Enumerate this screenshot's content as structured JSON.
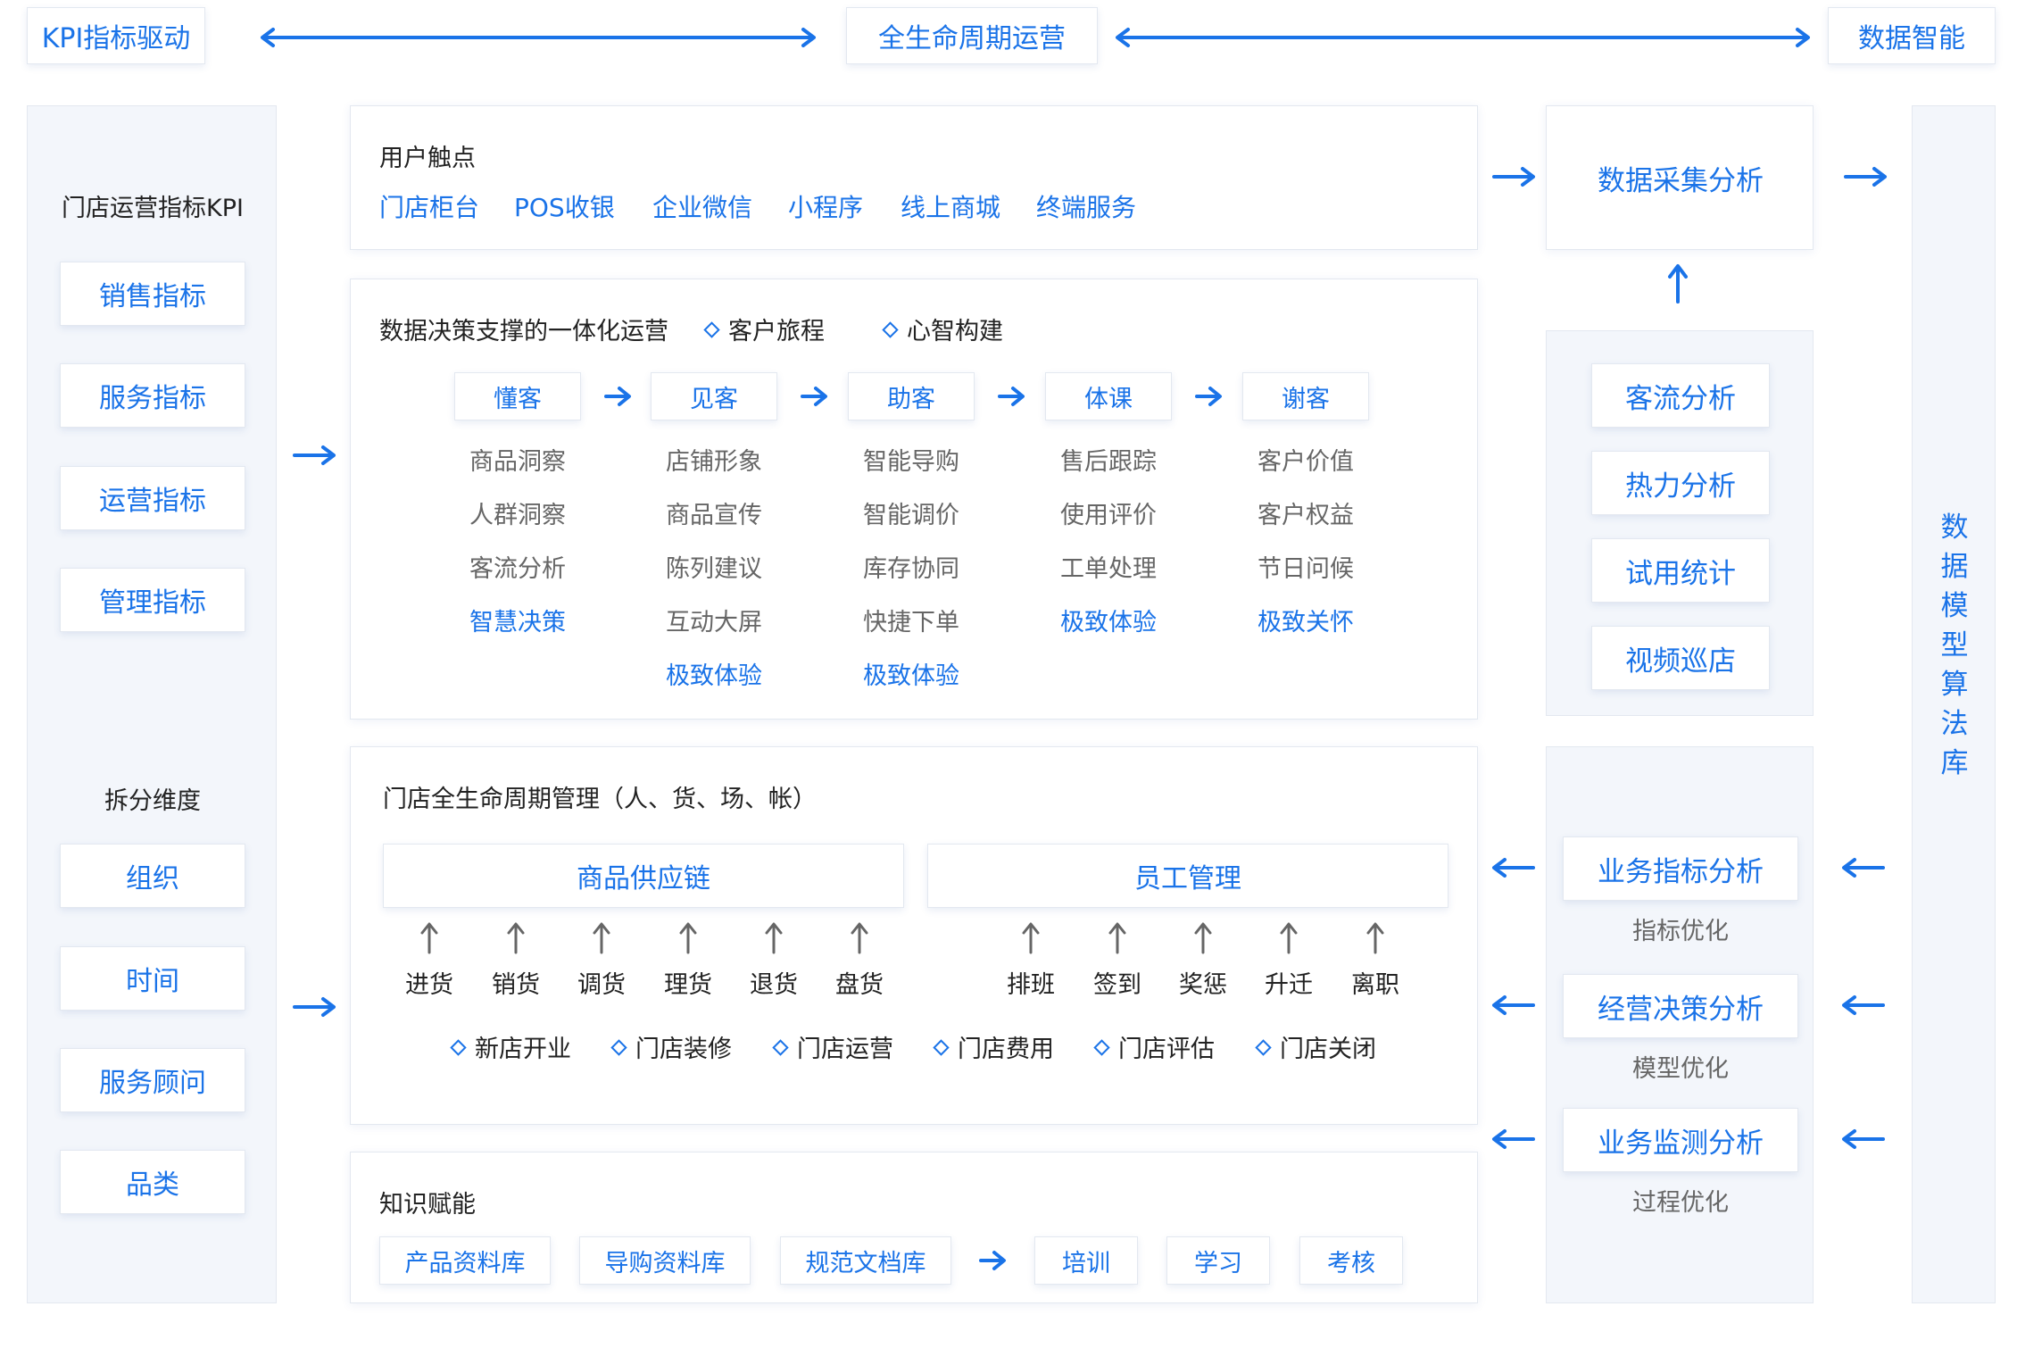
{
  "top": {
    "left": "KPI指标驱动",
    "center": "全生命周期运营",
    "right": "数据智能"
  },
  "left": {
    "kpi_title": "门店运营指标KPI",
    "kpi_items": [
      "销售指标",
      "服务指标",
      "运营指标",
      "管理指标"
    ],
    "dim_title": "拆分维度",
    "dim_items": [
      "组织",
      "时间",
      "服务顾问",
      "品类"
    ]
  },
  "touchpoints": {
    "title": "用户触点",
    "items": [
      "门店柜台",
      "POS收银",
      "企业微信",
      "小程序",
      "线上商城",
      "终端服务"
    ]
  },
  "ops": {
    "title": "数据决策支撑的一体化运营",
    "tags": [
      "客户旅程",
      "心智构建"
    ],
    "columns": [
      {
        "head": "懂客",
        "items": [
          {
            "t": "商品洞察",
            "hl": false
          },
          {
            "t": "人群洞察",
            "hl": false
          },
          {
            "t": "客流分析",
            "hl": false
          },
          {
            "t": "智慧决策",
            "hl": true
          }
        ]
      },
      {
        "head": "见客",
        "items": [
          {
            "t": "店铺形象",
            "hl": false
          },
          {
            "t": "商品宣传",
            "hl": false
          },
          {
            "t": "陈列建议",
            "hl": false
          },
          {
            "t": "互动大屏",
            "hl": false
          },
          {
            "t": "极致体验",
            "hl": true
          }
        ]
      },
      {
        "head": "助客",
        "items": [
          {
            "t": "智能导购",
            "hl": false
          },
          {
            "t": "智能调价",
            "hl": false
          },
          {
            "t": "库存协同",
            "hl": false
          },
          {
            "t": "快捷下单",
            "hl": false
          },
          {
            "t": "极致体验",
            "hl": true
          }
        ]
      },
      {
        "head": "体课",
        "items": [
          {
            "t": "售后跟踪",
            "hl": false
          },
          {
            "t": "使用评价",
            "hl": false
          },
          {
            "t": "工单处理",
            "hl": false
          },
          {
            "t": "极致体验",
            "hl": true
          }
        ]
      },
      {
        "head": "谢客",
        "items": [
          {
            "t": "客户价值",
            "hl": false
          },
          {
            "t": "客户权益",
            "hl": false
          },
          {
            "t": "节日问候",
            "hl": false
          },
          {
            "t": "极致关怀",
            "hl": true
          }
        ]
      }
    ]
  },
  "lifecycle": {
    "title": "门店全生命周期管理（人、货、场、帐）",
    "supply_title": "商品供应链",
    "supply_items": [
      "进货",
      "销货",
      "调货",
      "理货",
      "退货",
      "盘货"
    ],
    "staff_title": "员工管理",
    "staff_items": [
      "排班",
      "签到",
      "奖惩",
      "升迁",
      "离职"
    ],
    "stages": [
      "新店开业",
      "门店装修",
      "门店运营",
      "门店费用",
      "门店评估",
      "门店关闭"
    ]
  },
  "knowledge": {
    "title": "知识赋能",
    "libs": [
      "产品资料库",
      "导购资料库",
      "规范文档库"
    ],
    "steps": [
      "培训",
      "学习",
      "考核"
    ]
  },
  "right": {
    "collect": "数据采集分析",
    "analysis": [
      "客流分析",
      "热力分析",
      "试用统计",
      "视频巡店"
    ],
    "biz": [
      {
        "title": "业务指标分析",
        "sub": "指标优化"
      },
      {
        "title": "经营决策分析",
        "sub": "模型优化"
      },
      {
        "title": "业务监测分析",
        "sub": "过程优化"
      }
    ],
    "model_lib": [
      "数",
      "据",
      "模",
      "型",
      "算",
      "法",
      "库"
    ]
  },
  "colors": {
    "accent": "#1a73e8",
    "border": "#e3e8f0",
    "panel_grey": "#f3f6fb"
  }
}
